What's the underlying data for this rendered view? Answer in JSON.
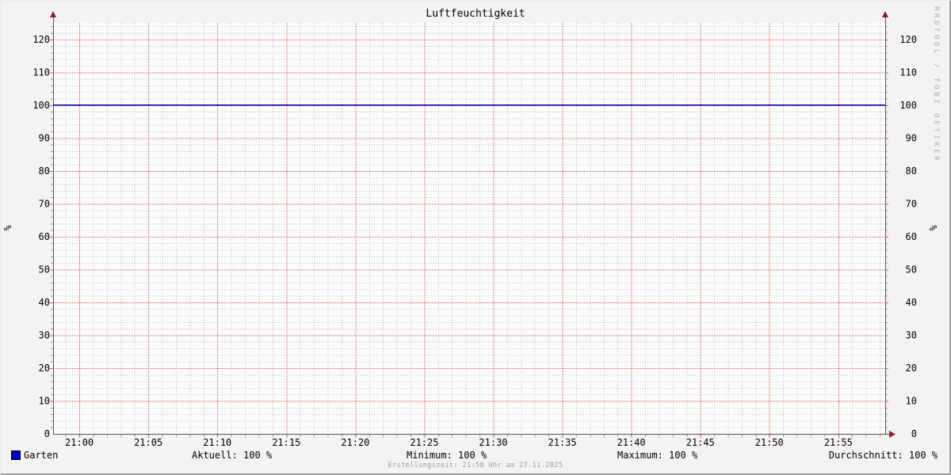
{
  "title": "Luftfeuchtigkeit",
  "watermark": "RRDTOOL / TOBI OETIKER",
  "footer": "Erstellungszeit: 21:58 Uhr am 27.11.2025",
  "legend": {
    "series_label": "Garten",
    "stats": [
      {
        "label": "Aktuell: 100 %"
      },
      {
        "label": "Minimum: 100 %"
      },
      {
        "label": "Maximum: 100 %"
      },
      {
        "label": "Durchschnitt: 100 %"
      }
    ]
  },
  "chart_data": {
    "type": "line",
    "title": "Luftfeuchtigkeit",
    "ylabel_left": "%",
    "ylabel_right": "%",
    "ylim": [
      0,
      125
    ],
    "y_major_step": 10,
    "y_minor_step": 2,
    "y_tick_labels": [
      "0",
      "10",
      "20",
      "30",
      "40",
      "50",
      "60",
      "70",
      "80",
      "90",
      "100",
      "110",
      "120"
    ],
    "x_axis": {
      "start_min": -1.9,
      "end_min": 58.4,
      "minor_step_min": 1,
      "major_ticks": [
        {
          "min": 0,
          "label": "21:00"
        },
        {
          "min": 5,
          "label": "21:05"
        },
        {
          "min": 10,
          "label": "21:10"
        },
        {
          "min": 15,
          "label": "21:15"
        },
        {
          "min": 20,
          "label": "21:20"
        },
        {
          "min": 25,
          "label": "21:25"
        },
        {
          "min": 30,
          "label": "21:30"
        },
        {
          "min": 35,
          "label": "21:35"
        },
        {
          "min": 40,
          "label": "21:40"
        },
        {
          "min": 45,
          "label": "21:45"
        },
        {
          "min": 50,
          "label": "21:50"
        },
        {
          "min": 55,
          "label": "21:55"
        }
      ]
    },
    "series": [
      {
        "name": "Garten",
        "color": "#0000CC",
        "points": [
          [
            -1.9,
            100
          ],
          [
            58.4,
            100
          ]
        ]
      }
    ],
    "colors": {
      "background": "#F3F3F3",
      "canvas": "#FBFBFB",
      "grid_major": "#DD5555",
      "grid_minor": "#BFBFBF",
      "tick_minor": "#999999",
      "axis": "#555555",
      "arrow": "#8B2222"
    }
  }
}
